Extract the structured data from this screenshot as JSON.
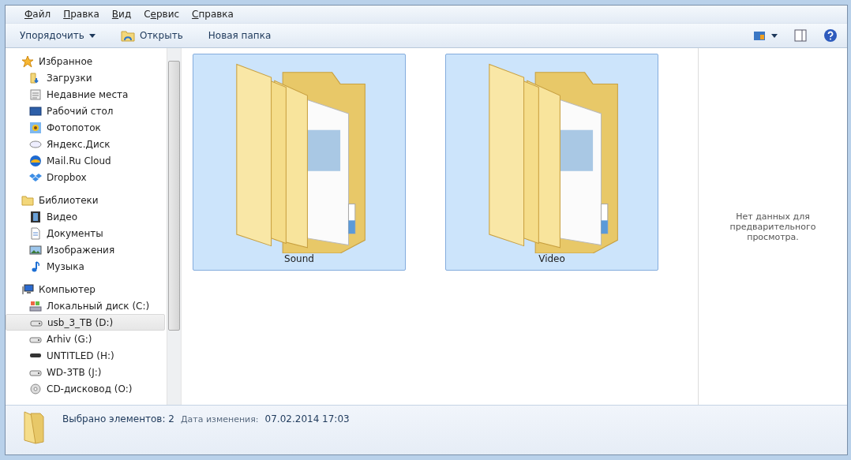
{
  "menu_bar": [
    {
      "access_key": "Ф",
      "rest": "айл"
    },
    {
      "access_key": "П",
      "rest": "равка"
    },
    {
      "access_key": "В",
      "rest": "ид"
    },
    {
      "lead": "С",
      "access_key": "е",
      "rest": "рвис"
    },
    {
      "access_key": "С",
      "rest": "правка"
    }
  ],
  "toolbar": {
    "organize": "Упорядочить",
    "open": "Открыть",
    "new_folder": "Новая папка"
  },
  "navigation": [
    {
      "label": "Избранное",
      "children": [
        {
          "label": "Загрузки",
          "selected": false
        },
        {
          "label": "Недавние места",
          "selected": false
        },
        {
          "label": "Рабочий стол",
          "selected": false
        },
        {
          "label": "Фотопоток",
          "selected": false
        },
        {
          "label": "Яндекс.Диск",
          "selected": false
        },
        {
          "label": "Mail.Ru Cloud",
          "selected": false
        },
        {
          "label": "Dropbox",
          "selected": false
        }
      ]
    },
    {
      "label": "Библиотеки",
      "children": [
        {
          "label": "Видео",
          "selected": false
        },
        {
          "label": "Документы",
          "selected": false
        },
        {
          "label": "Изображения",
          "selected": false
        },
        {
          "label": "Музыка",
          "selected": false
        }
      ]
    },
    {
      "label": "Компьютер",
      "children": [
        {
          "label": "Локальный диск (C:)",
          "selected": false
        },
        {
          "label": "usb_3_TB (D:)",
          "selected": true
        },
        {
          "label": "Arhiv (G:)",
          "selected": false
        },
        {
          "label": "UNTITLED (H:)",
          "selected": false
        },
        {
          "label": "WD-3TB (J:)",
          "selected": false
        },
        {
          "label": "CD-дисковод (O:)",
          "selected": false
        }
      ]
    }
  ],
  "items": [
    {
      "name": "Sound",
      "selected": true
    },
    {
      "name": "Video",
      "selected": true
    }
  ],
  "preview": "Нет данных для предварительного просмотра.",
  "details": {
    "count": "Выбрано элементов: 2",
    "modified_label": "Дата изменения:",
    "modified_value": "07.02.2014 17:03"
  }
}
